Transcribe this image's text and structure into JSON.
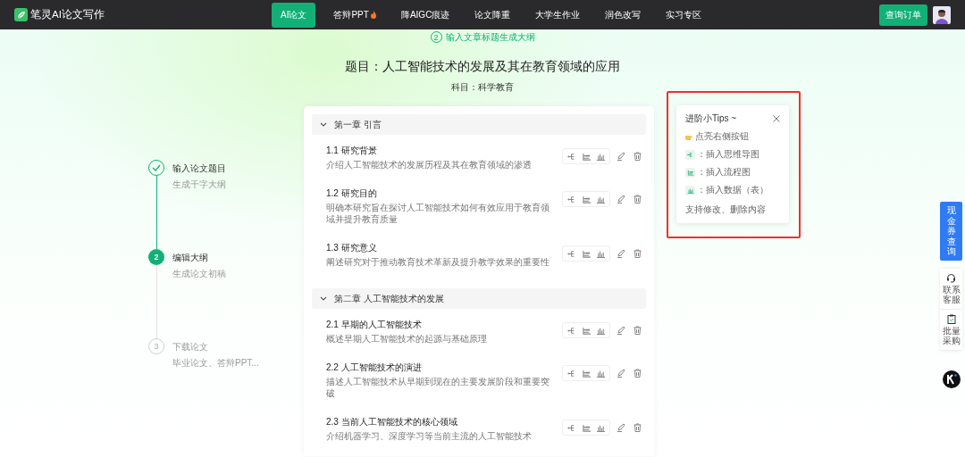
{
  "navbar": {
    "logo_text": "笔灵AI论文写作",
    "items": [
      {
        "label": "AI论文",
        "selected": true,
        "hot": false
      },
      {
        "label": "答辩PPT",
        "selected": false,
        "hot": true
      },
      {
        "label": "降AIGC痕迹",
        "selected": false,
        "hot": false
      },
      {
        "label": "论文降重",
        "selected": false,
        "hot": false
      },
      {
        "label": "大学生作业",
        "selected": false,
        "hot": false
      },
      {
        "label": "润色改写",
        "selected": false,
        "hot": false
      },
      {
        "label": "实习专区",
        "selected": false,
        "hot": false
      }
    ],
    "order_button": "查询订单"
  },
  "step_banner": {
    "number": "2",
    "text": "输入文章标题生成大纲"
  },
  "title": "题目：人工智能技术的发展及其在教育领域的应用",
  "subject": "科目：科学教育",
  "steps": [
    {
      "title": "输入论文题目",
      "subtitle": "生成千字大纲",
      "completed": true,
      "selected": false
    },
    {
      "number": "2",
      "title": "编辑大纲",
      "subtitle": "生成论文初稿",
      "completed": false,
      "selected": true
    },
    {
      "number": "3",
      "title": "下载论文",
      "subtitle": "毕业论文、答辩PPT...",
      "completed": false,
      "selected": false
    }
  ],
  "outline": [
    {
      "title": "第一章 引言",
      "expanded": true,
      "sections": [
        {
          "title": "1.1 研究背景",
          "desc": "介绍人工智能技术的发展历程及其在教育领域的渗透"
        },
        {
          "title": "1.2 研究目的",
          "desc": "明确本研究旨在探讨人工智能技术如何有效应用于教育领域并提升教育质量"
        },
        {
          "title": "1.3 研究意义",
          "desc": "阐述研究对于推动教育技术革新及提升教学效果的重要性"
        }
      ]
    },
    {
      "title": "第二章 人工智能技术的发展",
      "expanded": true,
      "sections": [
        {
          "title": "2.1 早期的人工智能技术",
          "desc": "概述早期人工智能技术的起源与基础原理"
        },
        {
          "title": "2.2 人工智能技术的演进",
          "desc": "描述人工智能技术从早期到现在的主要发展阶段和重要突破"
        },
        {
          "title": "2.3 当前人工智能技术的核心领域",
          "desc": "介绍机器学习、深度学习等当前主流的人工智能技术"
        }
      ]
    }
  ],
  "tips": {
    "title": "进阶小Tips ~",
    "intro": "点亮右侧按钮",
    "items": [
      {
        "kind": "mindmap",
        "text": "：插入思维导图"
      },
      {
        "kind": "flowchart",
        "text": "：插入流程图"
      },
      {
        "kind": "chart",
        "text": "：插入数据（表）"
      }
    ],
    "footer": "支持修改、删除内容"
  },
  "float": {
    "coupon": "现金券查询",
    "items": [
      {
        "kind": "service",
        "text": "联系客服"
      },
      {
        "kind": "bulk",
        "text": "批量采购"
      }
    ]
  }
}
